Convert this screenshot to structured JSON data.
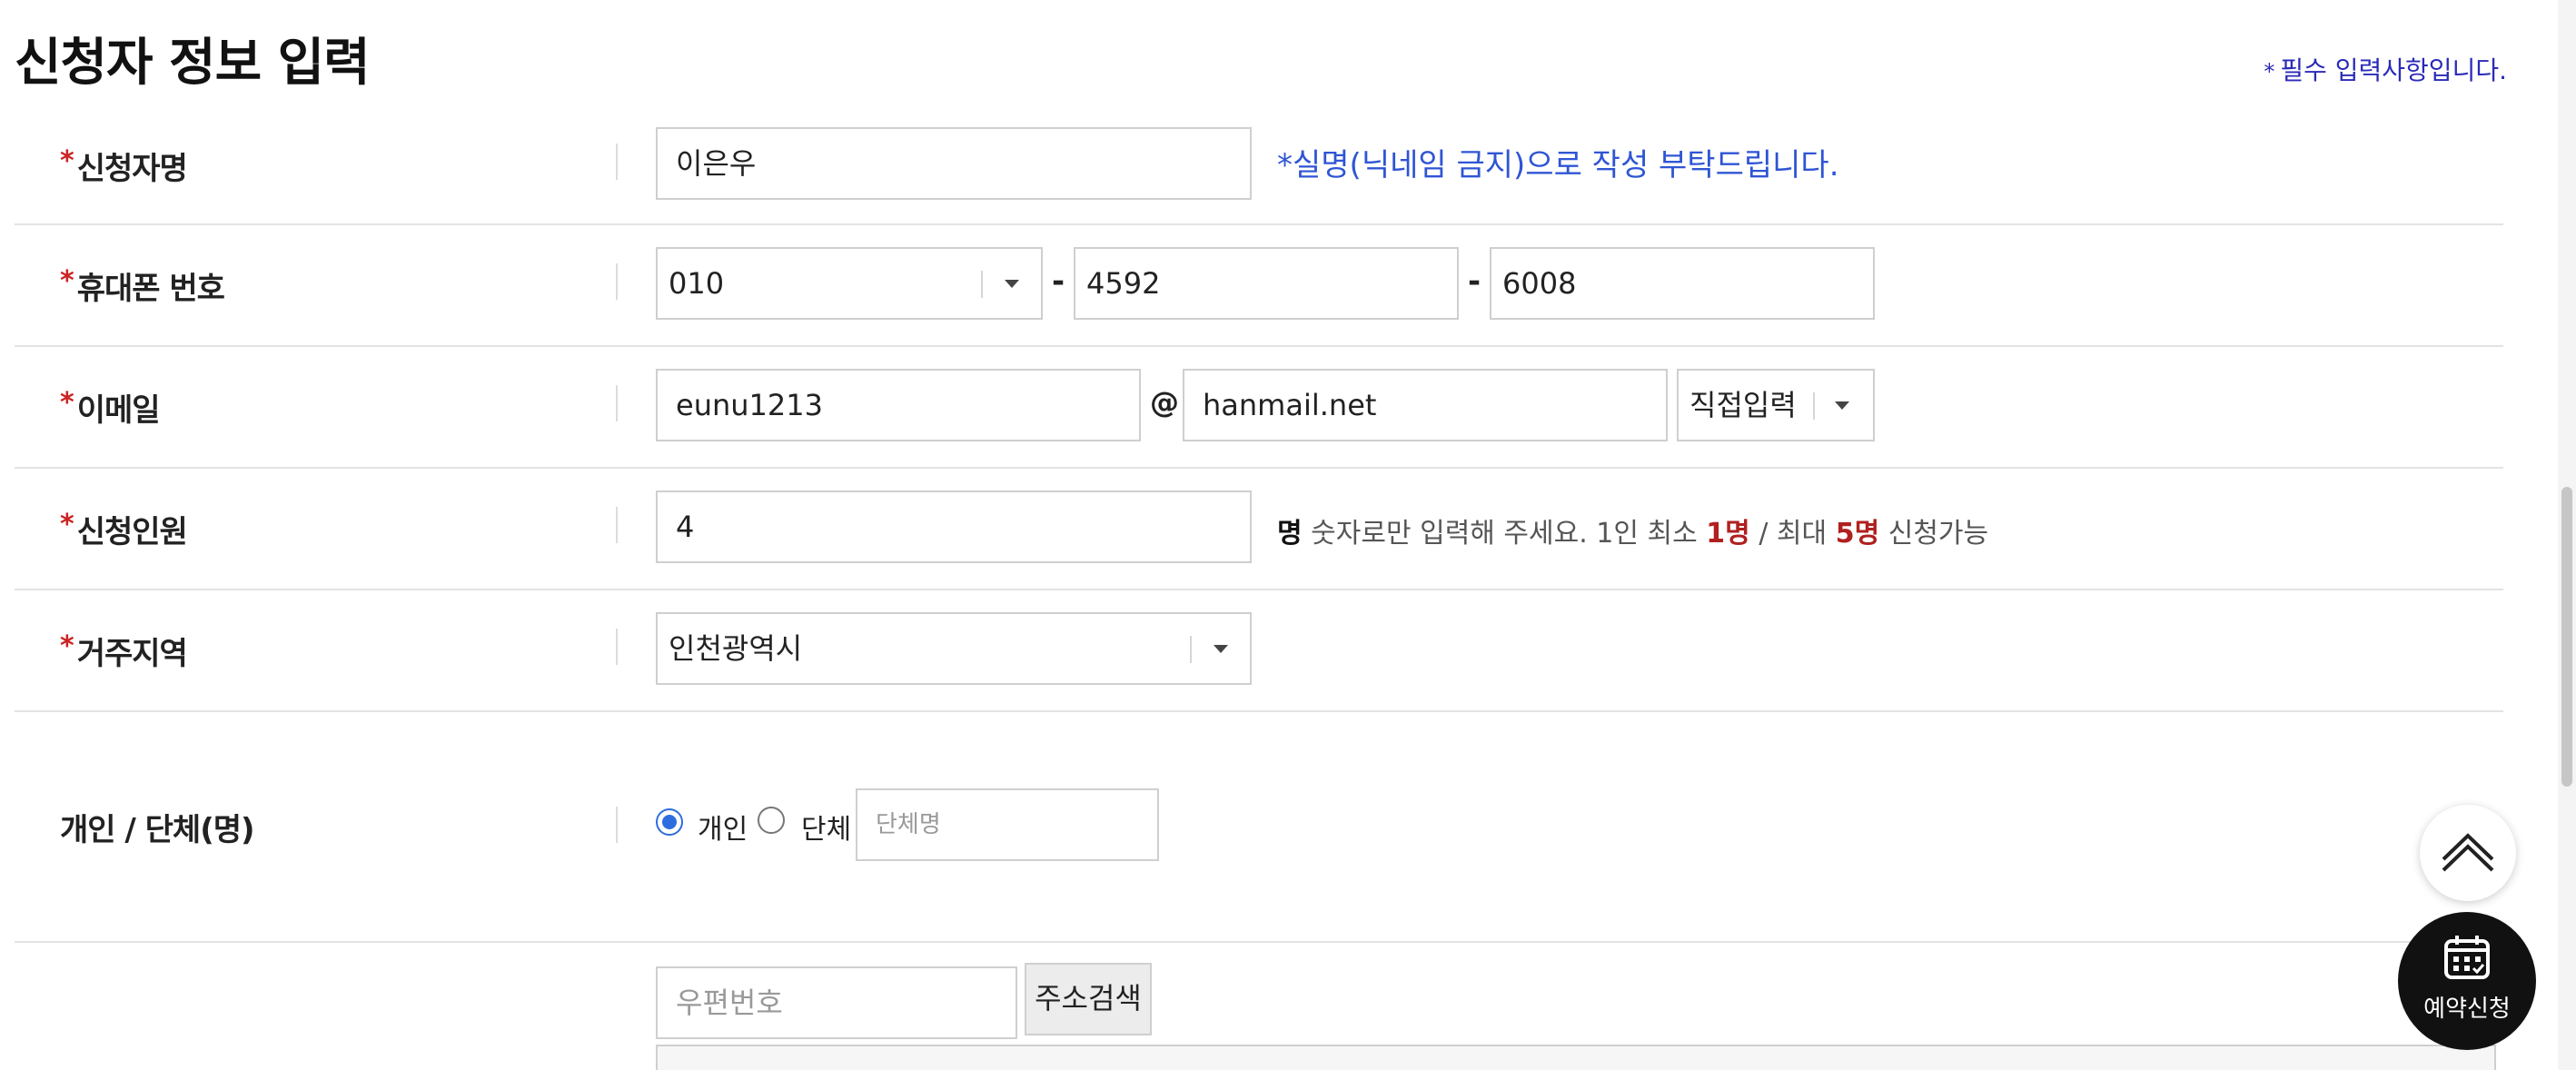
{
  "page": {
    "title": "신청자 정보 입력",
    "required_note": "필수 입력사항입니다.",
    "required_mark": "*"
  },
  "name_row": {
    "label": "신청자명",
    "value": "이은우",
    "hint": "*실명(닉네임 금지)으로 작성 부탁드립니다."
  },
  "phone_row": {
    "label": "휴대폰 번호",
    "prefix": "010",
    "middle": "4592",
    "last": "6008",
    "dash": "-"
  },
  "email_row": {
    "label": "이메일",
    "id": "eunu1213",
    "at": "@",
    "domain": "hanmail.net",
    "domain_select": "직접입력"
  },
  "people_row": {
    "label": "신청인원",
    "value": "4",
    "unit": "명",
    "hint_a": "숫자로만 입력해 주세요. 1인 최소",
    "min": "1명",
    "hint_b": "/ 최대",
    "max": "5명",
    "hint_c": "신청가능"
  },
  "region_row": {
    "label": "거주지역",
    "value": "인천광역시"
  },
  "type_row": {
    "label": "개인 / 단체(명)",
    "option_individual": "개인",
    "option_group": "단체",
    "selected": "개인",
    "group_placeholder": "단체명"
  },
  "address_row": {
    "postcode_placeholder": "우편번호",
    "search_button": "주소검색"
  },
  "floating": {
    "reserve_label": "예약신청",
    "top_icon": "chevron-up-icon",
    "calendar_icon": "calendar-icon"
  },
  "colors": {
    "required": "#cc2222",
    "hint_blue": "#2f55d4",
    "limit_red": "#b02020",
    "radio_checked": "#2e6de0"
  }
}
